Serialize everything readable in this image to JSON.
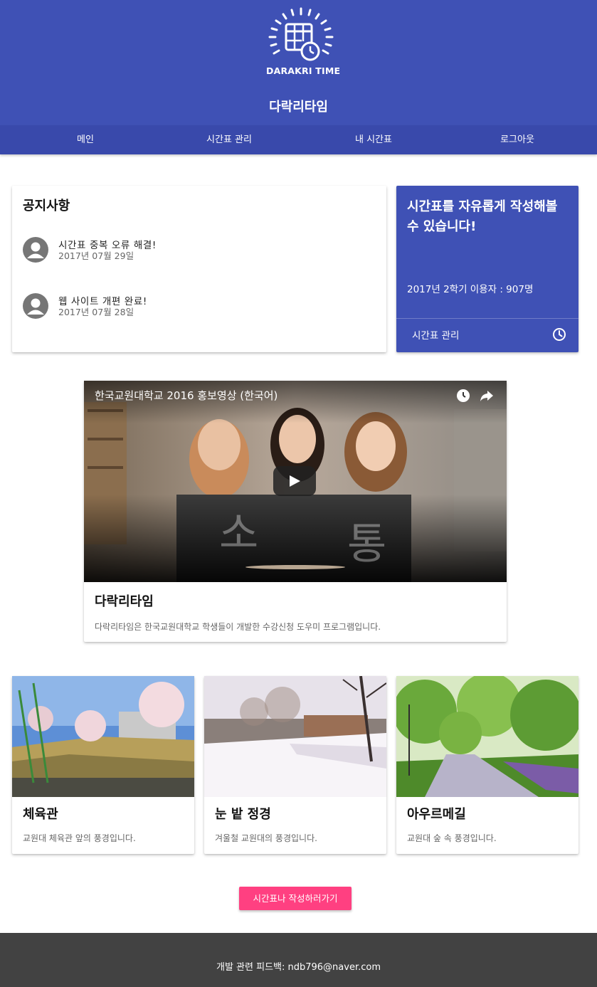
{
  "header": {
    "logo_text": "DARAKRI TIME",
    "site_title": "다락리타임"
  },
  "nav": {
    "items": [
      {
        "label": "메인"
      },
      {
        "label": "시간표 관리"
      },
      {
        "label": "내 시간표"
      },
      {
        "label": "로그아웃"
      }
    ]
  },
  "notice": {
    "title": "공지사항",
    "items": [
      {
        "text": "시간표 중복 오류 해결!",
        "date": "2017년 07월 29일"
      },
      {
        "text": "웹 사이트 개편 완료!",
        "date": "2017년 07월 28일"
      }
    ]
  },
  "promo": {
    "title": "시간표를 자유롭게 작성해볼 수 있습니다!",
    "users": "2017년 2학기 이용자 : 907명",
    "action_label": "시간표 관리",
    "icon": "clock-icon"
  },
  "video_card": {
    "video_title": "한국교원대학교 2016 홍보영상 (한국어)",
    "name": "다락리타임",
    "description": "다락리타임은 한국교원대학교 학생들이 개발한 수강신청 도우미 프로그램입니다."
  },
  "photos": [
    {
      "name": "체육관",
      "description": "교원대 체육관 앞의 풍경입니다."
    },
    {
      "name": "눈 밭 정경",
      "description": "겨울철 교원대의 풍경입니다."
    },
    {
      "name": "아우르메길",
      "description": "교원대 숲 속 풍경입니다."
    }
  ],
  "cta": {
    "label": "시간표나 작성하러가기"
  },
  "footer": {
    "text": "개발 관련 피드백: ndb796@naver.com"
  },
  "colors": {
    "primary": "#3f51b5",
    "nav": "#3949ab",
    "accent": "#ff4081",
    "footer": "#424242"
  }
}
